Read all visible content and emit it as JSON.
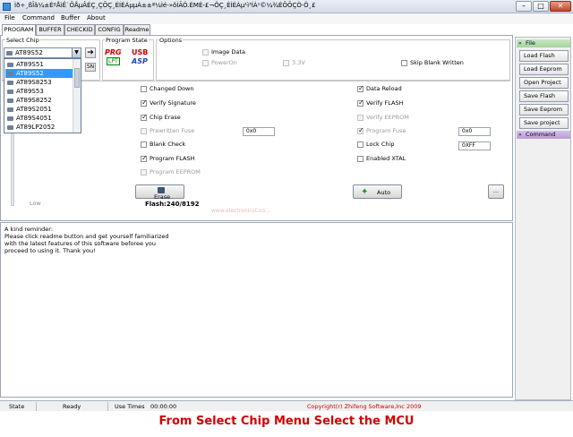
{
  "window": {
    "title": "Ìð÷¸ßÎâ¼±ÉºÅìÊ`ÕÅµÂÉÇ¸ÇÕÇ¸ÉÍÉÁµµÁ±±ª¼Ìé-»ôÌÃÓ.ÉMÉ-£¬ÖÇ¸ÉÍÉÁµ¹ì³ÍÁ¹©¼¾ÉÕÕÇÒ·Ö¸£",
    "minimize": "–",
    "maximize": "□",
    "close": "✕"
  },
  "menu": [
    "File",
    "Command",
    "Buffer",
    "About"
  ],
  "tabs": [
    "PROGRAM",
    "BUFFER",
    "CHECKID",
    "CONFIG",
    "Readme"
  ],
  "select_chip": {
    "label": "Select Chip",
    "value": "AT89S52",
    "options": [
      "AT89S51",
      "AT89S52",
      "AT89S8253",
      "AT89S53",
      "AT89S8252",
      "AT89S2051",
      "AT89S4051",
      "AT89LP2052"
    ],
    "selected_index": 1,
    "sn_label": "SN",
    "go_icon": "➔"
  },
  "program_state": {
    "label": "Program State",
    "prg": "PRG",
    "lpt": "LPT",
    "usb": "USB",
    "asp": "ASP"
  },
  "options": {
    "label": "Options",
    "image_data": "Image Data",
    "power_on": "PowerOn",
    "v33": "3.3V",
    "skip_blank": "Skip Blank Written"
  },
  "checks": {
    "changed_down": "Changed Down",
    "verify_signature": "Verify Signature",
    "chip_erase": "Chip Erase",
    "prewritten_fuse": "Prewritten Fuse",
    "prewritten_fuse_value": "0x0",
    "blank_check": "Blank Check",
    "program_flash": "Program FLASH",
    "program_eeprom": "Program EEPROM",
    "data_reload": "Data Reload",
    "verify_flash": "Verify FLASH",
    "verify_eeprom": "Verify EEPROM",
    "program_fuse": "Program Fuse",
    "program_fuse_value": "0x0",
    "lock_chip": "Lock Chip",
    "lock_chip_value": "0XFF",
    "enabled_xtal": "Enabled XTAL"
  },
  "slider_low": "Low",
  "buttons": {
    "erase": "Erase",
    "auto": "Auto",
    "more": "..."
  },
  "flash_info": "Flash:240/8192",
  "watermark": "www.electronicsCoo...",
  "message_lines": [
    "A kind reminder:",
    "Please click readme button and get yourself familiarized",
    "with the latest features of this software beforee you",
    "proceed to using it. Thank you!"
  ],
  "right_panel": {
    "file_header": "File",
    "buttons": [
      "Load Flash",
      "Load Eeprom",
      "Open Project",
      "Save Flash",
      "Save Eeprom",
      "Save project"
    ],
    "command_header": "Command"
  },
  "status": {
    "state_label": "State",
    "state_value": "Ready",
    "use_times_label": "Use Times",
    "use_times_value": "00:00:00",
    "copyright": "Copyright(r) Zhifeng Software,Inc 2009"
  },
  "caption": "From Select Chip Menu Select the MCU",
  "colors": {
    "accent_select": "#3399ff",
    "caption": "#d40000",
    "copyright": "#cc0000"
  }
}
